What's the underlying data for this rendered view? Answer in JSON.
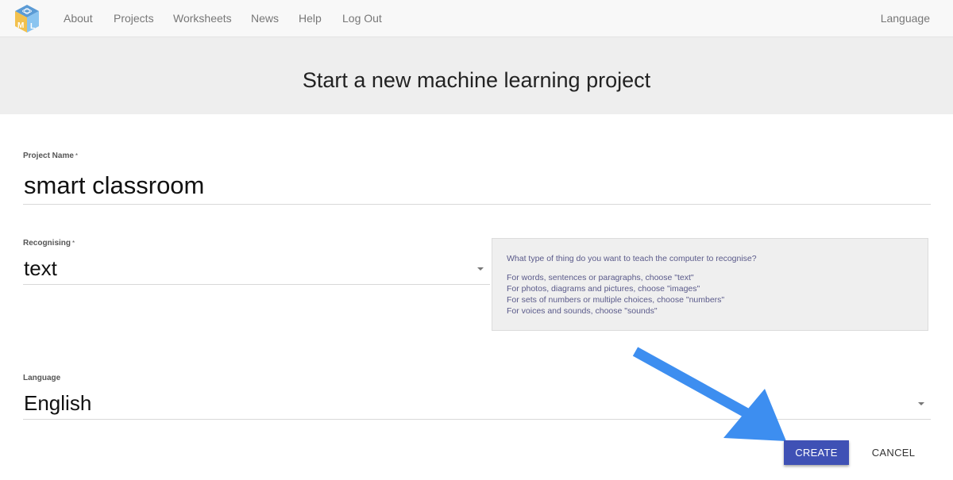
{
  "nav": {
    "logo": "ML",
    "links": [
      "About",
      "Projects",
      "Worksheets",
      "News",
      "Help",
      "Log Out"
    ],
    "language": "Language"
  },
  "page": {
    "title": "Start a new machine learning project"
  },
  "form": {
    "project_name": {
      "label": "Project Name",
      "required_mark": "*",
      "value": "smart classroom"
    },
    "recognising": {
      "label": "Recognising",
      "required_mark": "*",
      "value": "text"
    },
    "language": {
      "label": "Language",
      "value": "English"
    }
  },
  "help": {
    "question": "What type of thing do you want to teach the computer to recognise?",
    "lines": [
      "For words, sentences or paragraphs, choose \"text\"",
      "For photos, diagrams and pictures, choose \"images\"",
      "For sets of numbers or multiple choices, choose \"numbers\"",
      "For voices and sounds, choose \"sounds\""
    ]
  },
  "buttons": {
    "create": "CREATE",
    "cancel": "CANCEL"
  },
  "colors": {
    "primary": "#3f51b5",
    "arrow": "#3d8ef0",
    "hero_bg": "#eeeeee",
    "navbar_bg": "#f8f8f8"
  }
}
